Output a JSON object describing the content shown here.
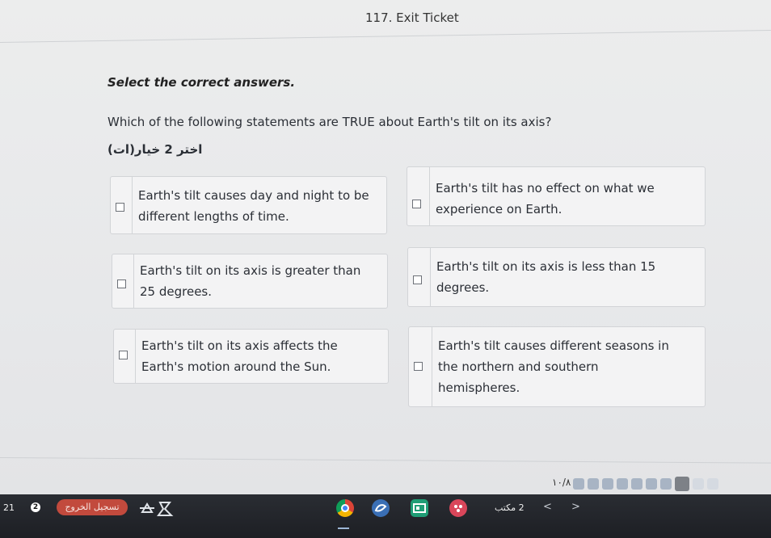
{
  "header": {
    "title": "117. Exit Ticket"
  },
  "instructions": "Select the correct answers.",
  "question": "Which of the following statements are TRUE about Earth's tilt on its axis?",
  "hint": "اختر 2 خيار(ات)",
  "options": [
    {
      "text": "Earth's tilt causes day and night to be\ndifferent lengths of time.",
      "checked": false
    },
    {
      "text": "Earth's tilt has no effect on what we\nexperience on Earth.",
      "checked": false
    },
    {
      "text": "Earth's tilt on its axis is greater than\n25 degrees.",
      "checked": false
    },
    {
      "text": "Earth's tilt on its axis is less than 15\ndegrees.",
      "checked": false
    },
    {
      "text": "Earth's tilt on its axis affects the\nEarth's motion around the Sun.",
      "checked": false
    },
    {
      "text": "Earth's tilt causes different seasons in\nthe northern and southern\nhemispheres.",
      "checked": false
    }
  ],
  "pager": {
    "label": "١٠/٨"
  },
  "taskbar": {
    "time": "21",
    "badge": "2",
    "pill_label": "تسجيل الخروج",
    "pages_label": "2 مكتب",
    "nav": "< >"
  },
  "colors": {
    "accent_pill": "#c24a3d",
    "pager_dot": "#a8b4c4",
    "pager_current": "#7d8187"
  }
}
